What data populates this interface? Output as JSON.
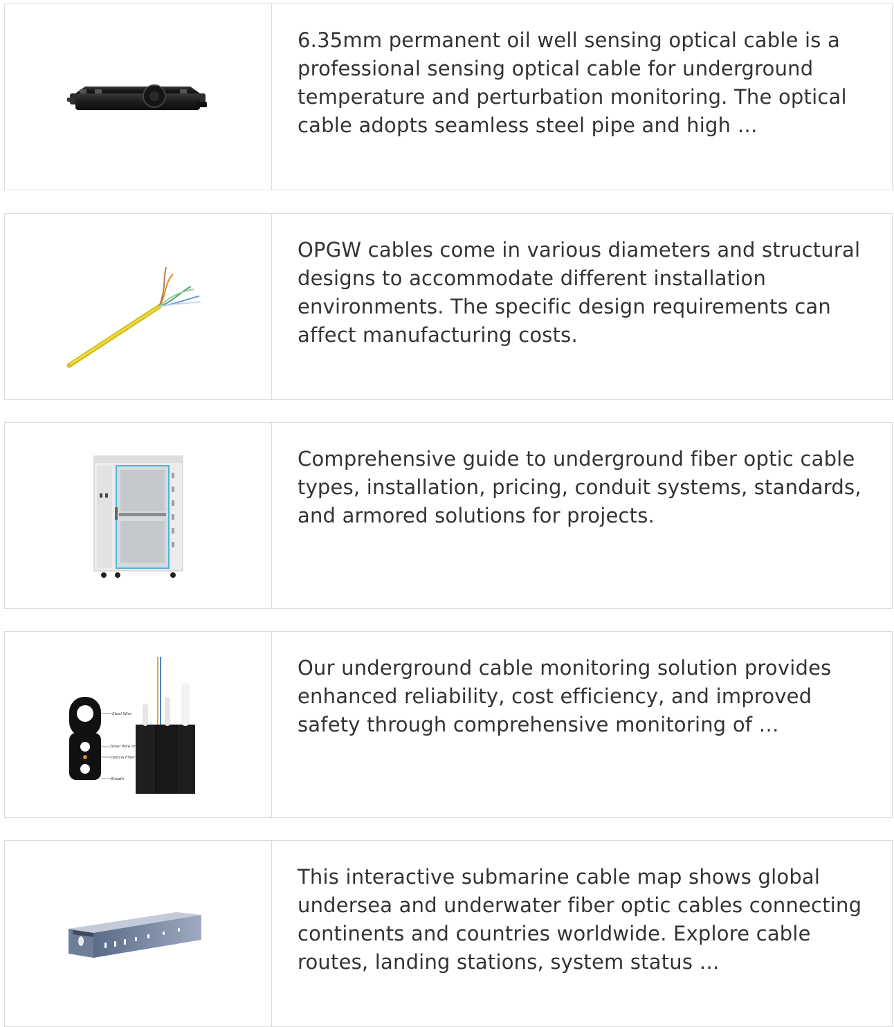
{
  "results": [
    {
      "image_icon": "black-fiber-splice-closure-icon",
      "description": "6.35mm permanent oil well sensing optical cable is a professional sensing optical cable for underground temperature and perturbation monitoring. The optical cable adopts seamless steel pipe and high …"
    },
    {
      "image_icon": "yellow-network-cable-icon",
      "description": "OPGW cables come in various diameters and structural designs to accommodate different installation environments. The specific design requirements can affect manufacturing costs."
    },
    {
      "image_icon": "server-rack-cabinet-icon",
      "description": "Comprehensive guide to underground fiber optic cable types, installation, pricing, conduit systems, standards, and armored solutions for projects."
    },
    {
      "image_icon": "drop-cable-cross-section-icon",
      "description": "Our underground cable monitoring solution provides enhanced reliability, cost efficiency, and improved safety through comprehensive monitoring of …",
      "diagram_labels": {
        "steel_wire": "Steel Wire",
        "steel_wire_frp": "Steel Wire or FRP",
        "optical_fiber": "Optical Fiber",
        "sheath": "Sheath"
      }
    },
    {
      "image_icon": "metal-cable-tray-icon",
      "description": "This interactive submarine cable map shows global undersea and underwater fiber optic cables connecting continents and countries worldwide. Explore cable routes, landing stations, system status …"
    }
  ]
}
